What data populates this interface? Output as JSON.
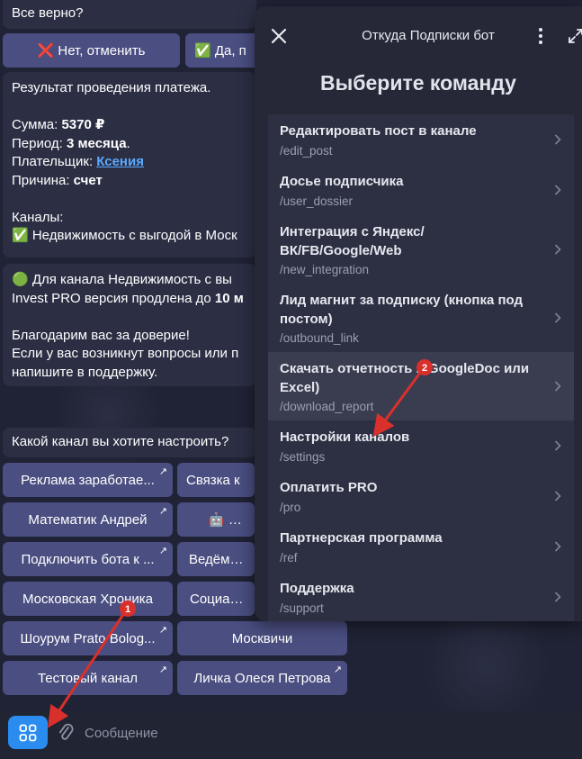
{
  "chat": {
    "confirm_question": "Все верно?",
    "btn_no": "❌ Нет, отменить",
    "btn_yes": "✅ Да, п",
    "payment": {
      "title": "Результат проведения платежа.",
      "sum_label": "Сумма: ",
      "sum_value": "5370 ₽",
      "period_label": "Период: ",
      "period_value": "3 месяца",
      "period_suffix": ".",
      "payer_label": "Плательщик: ",
      "payer_value": "Ксения",
      "reason_label": "Причина: ",
      "reason_value": "счет",
      "channels_label": "Каналы:",
      "channel_item": "✅ Недвижимость с выгодой в Моск"
    },
    "extension": {
      "line1": "🟢 Для канала Недвижимость с вы",
      "line2_prefix": "Invest PRO версия продлена до ",
      "line2_bold": "10 м",
      "line3": "Благодарим вас за доверие!",
      "line4": "Если у вас возникнут вопросы или п",
      "line5": "напишите в поддержку."
    },
    "channel_question": "Какой канал вы хотите настроить?",
    "channel_buttons": [
      {
        "label": "Реклама заработае..."
      },
      {
        "label": "Связка к"
      },
      {
        "label": "Математик Андрей"
      },
      {
        "label": "🤖 Stag"
      },
      {
        "label": "Подключить бота к ..."
      },
      {
        "label": "Ведём на"
      },
      {
        "label": "Московская Хроника"
      },
      {
        "label": "Социальн"
      },
      {
        "label": "Шоурум Prato Bolog..."
      },
      {
        "label": "Москвичи"
      },
      {
        "label": "Тестовый канал"
      },
      {
        "label": "Личка Олеся Петрова"
      }
    ]
  },
  "composer": {
    "placeholder": "Сообщение"
  },
  "panel": {
    "title": "Откуда Подписки бот",
    "heading": "Выберите команду",
    "commands": [
      {
        "title": "Редактировать пост в канале",
        "code": "/edit_post"
      },
      {
        "title": "Досье подписчика",
        "code": "/user_dossier"
      },
      {
        "title": "Интеграция с Яндекс/ ВК/FB/Google/Web",
        "code": "/new_integration"
      },
      {
        "title": "Лид магнит за подписку (кнопка под постом)",
        "code": "/outbound_link"
      },
      {
        "title": "Скачать отчетность в GoogleDoc или Excel)",
        "code": "/download_report"
      },
      {
        "title": "Настройки каналов",
        "code": "/settings"
      },
      {
        "title": "Оплатить PRO",
        "code": "/pro"
      },
      {
        "title": "Партнерская программа",
        "code": "/ref"
      },
      {
        "title": "Поддержка",
        "code": "/support"
      }
    ]
  },
  "annotations": {
    "marker1": "1",
    "marker2": "2"
  },
  "colors": {
    "accent": "#2b8cf0",
    "keyboard_button": "#4a4e80",
    "annotation_red": "#d9302c",
    "link": "#5aa9ff"
  }
}
